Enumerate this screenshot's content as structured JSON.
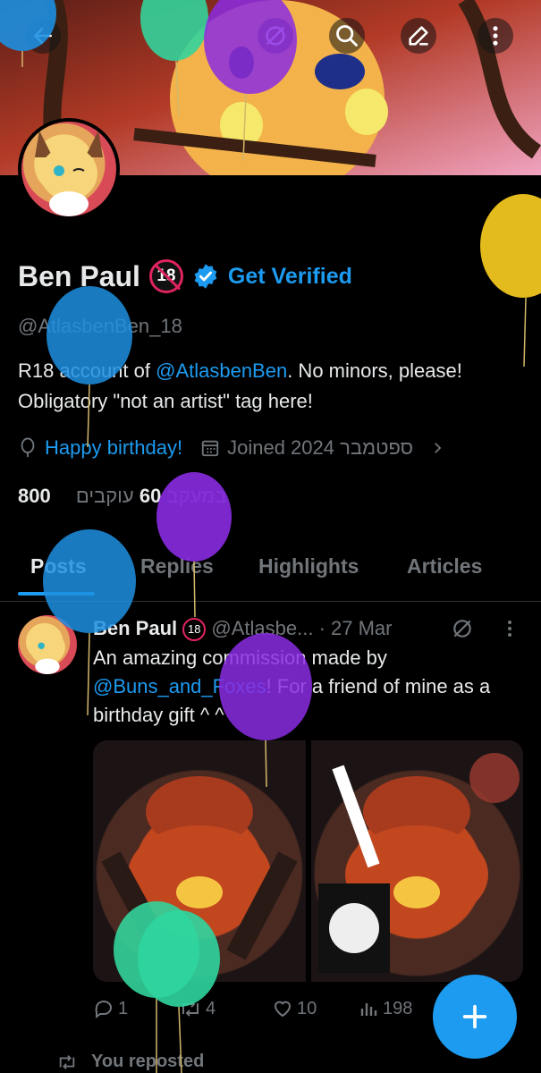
{
  "profile": {
    "display_name": "Ben Paul",
    "age_badge": "18",
    "get_verified": "Get Verified",
    "handle": "@AtlasbenBen_18",
    "bio_prefix": "R18 account of ",
    "bio_mention": "@AtlasbenBen",
    "bio_suffix": ". No minors, please! Obligatory \"not an artist\" tag here!",
    "birthday": "Happy birthday!",
    "joined": "Joined 2024 ספטמבר",
    "following_count": "800",
    "following_label": "במעקב",
    "followers_count": "60",
    "followers_label": "עוקבים"
  },
  "tabs": [
    "Posts",
    "Replies",
    "Highlights",
    "Articles"
  ],
  "post": {
    "name": "Ben Paul",
    "age_badge": "18",
    "handle": "@Atlasbe...",
    "date": "· 27 Mar",
    "text_prefix": "An amazing commission made by ",
    "text_mention": "@Buns_and_Foxes",
    "text_suffix": "! For a friend of mine as a birthday gift ^ ^",
    "replies": "1",
    "reposts": "4",
    "likes": "10",
    "views": "198"
  },
  "repost_note": "You reposted",
  "icons": [
    "back-arrow-icon",
    "grok-icon",
    "search-icon",
    "edit-icon",
    "more-icon",
    "verified-icon",
    "balloon-icon",
    "calendar-icon",
    "chevron-right-icon",
    "reply-icon",
    "repost-icon",
    "like-icon",
    "views-icon",
    "plus-icon"
  ],
  "colors": {
    "accent": "#1d9bf0",
    "background": "#000000",
    "text": "#e7e9ea",
    "muted": "#71767b"
  }
}
